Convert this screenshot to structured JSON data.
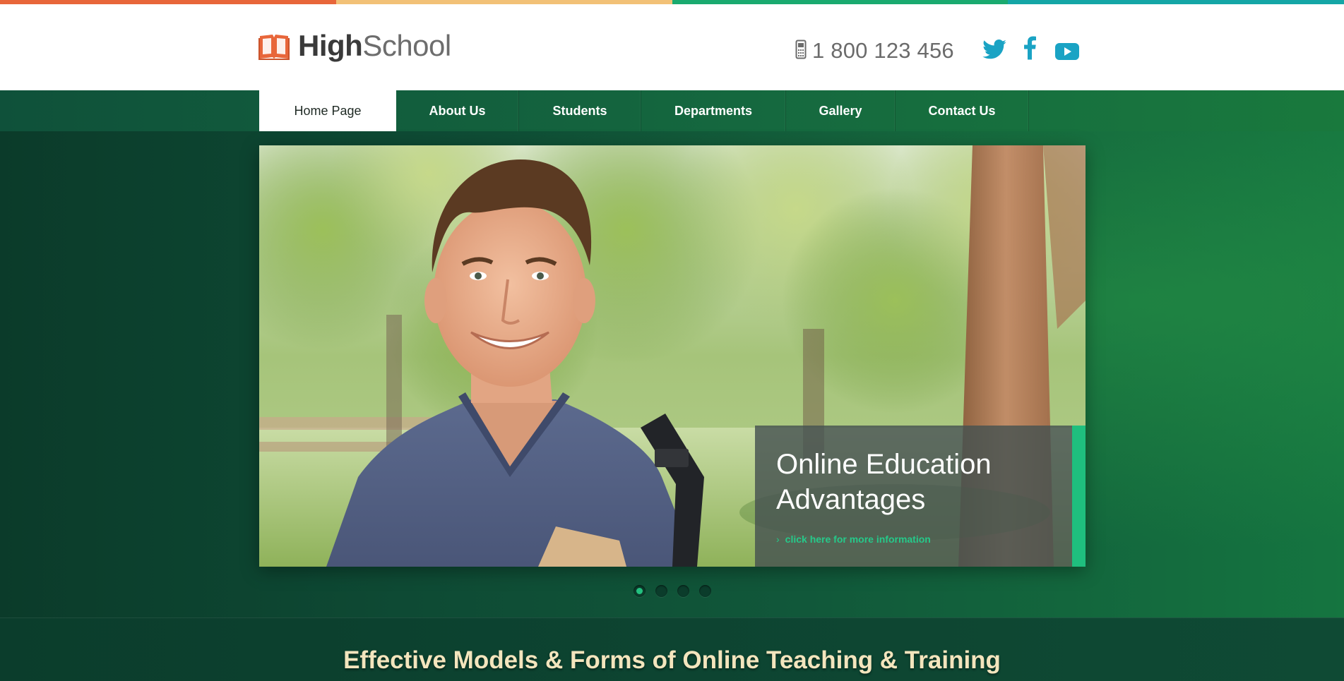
{
  "colors": {
    "strip": [
      "#e8663a",
      "#f2c177",
      "#1aaa6f",
      "#14a6a6"
    ],
    "accent_orange": "#e8663a",
    "social_teal": "#1aa3c4",
    "caption_accent": "#1fbf7e"
  },
  "header": {
    "logo_icon": "open-book-icon",
    "logo_bold": "High",
    "logo_light": "School",
    "phone_icon": "mobile-phone-icon",
    "phone": "1 800 123 456",
    "social": [
      {
        "name": "twitter-icon"
      },
      {
        "name": "facebook-icon"
      },
      {
        "name": "youtube-icon"
      }
    ]
  },
  "nav": {
    "items": [
      {
        "label": "Home Page",
        "active": true
      },
      {
        "label": "About Us",
        "active": false
      },
      {
        "label": "Students",
        "active": false
      },
      {
        "label": "Departments",
        "active": false
      },
      {
        "label": "Gallery",
        "active": false
      },
      {
        "label": "Contact Us",
        "active": false
      }
    ]
  },
  "slider": {
    "caption_title": "Online Education Advantages",
    "caption_link": "click here for more information",
    "link_icon": "chevron-right-icon",
    "slide_count": 4,
    "active_slide": 1
  },
  "band": {
    "title": "Effective Models & Forms of Online Teaching & Training"
  }
}
